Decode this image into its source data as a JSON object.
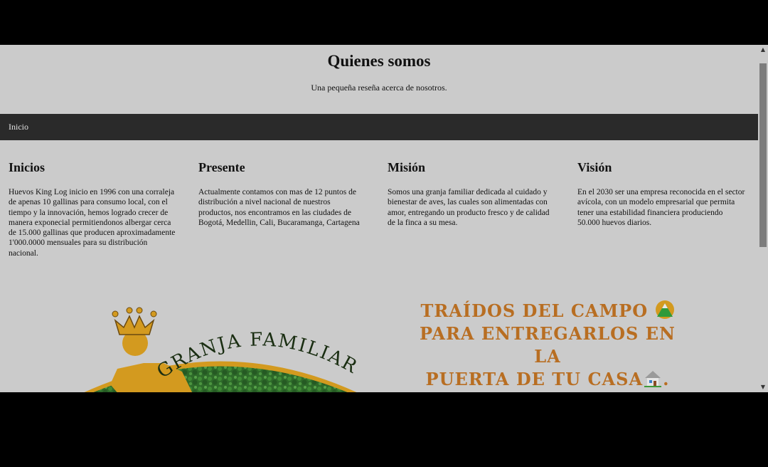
{
  "hero": {
    "title": "Quienes somos",
    "subtitle": "Una pequeña reseña acerca de nosotros."
  },
  "nav": {
    "items": [
      "Inicio"
    ]
  },
  "sections": [
    {
      "title": "Inicios",
      "text": "Huevos King Log inicio en 1996 con una corraleja de apenas 10 gallinas para consumo local, con el tiempo y la innovación, hemos logrado crecer de manera exponecial permitiendonos albergar cerca de 15.000 gallinas que producen aproximadamente 1'000.0000 mensuales para su distribución nacional."
    },
    {
      "title": "Presente",
      "text": "Actualmente contamos con mas de 12 puntos de distribución a nivel nacional de nuestros productos, nos encontramos en las ciudades de Bogotá, Medellin, Cali, Bucaramanga, Cartagena"
    },
    {
      "title": "Misión",
      "text": "Somos una granja familiar dedicada al cuidado y bienestar de aves, las cuales son alimentadas con amor, entregando un producto fresco y de calidad de la finca a su mesa."
    },
    {
      "title": "Visión",
      "text": "En el 2030 ser una empresa reconocida en el sector avícola, con un modelo empresarial que permita tener una estabilidad financiera produciendo 50.000 huevos diarios."
    }
  ],
  "logo": {
    "text": "GRANJA FAMILIAR"
  },
  "slogan": {
    "line1": "Traídos del campo",
    "line2": "para entregarlos en la",
    "line3": "puerta de tu casa",
    "line3_end": "."
  },
  "icons": {
    "mountain": "mountain-emoji-icon",
    "house": "house-emoji-icon"
  },
  "colors": {
    "page_bg": "#cbcbcb",
    "nav_bg": "#2a2a2a",
    "slogan": "#b86e22",
    "logo_gold": "#d39a1f",
    "logo_green": "#2e6a2a"
  }
}
